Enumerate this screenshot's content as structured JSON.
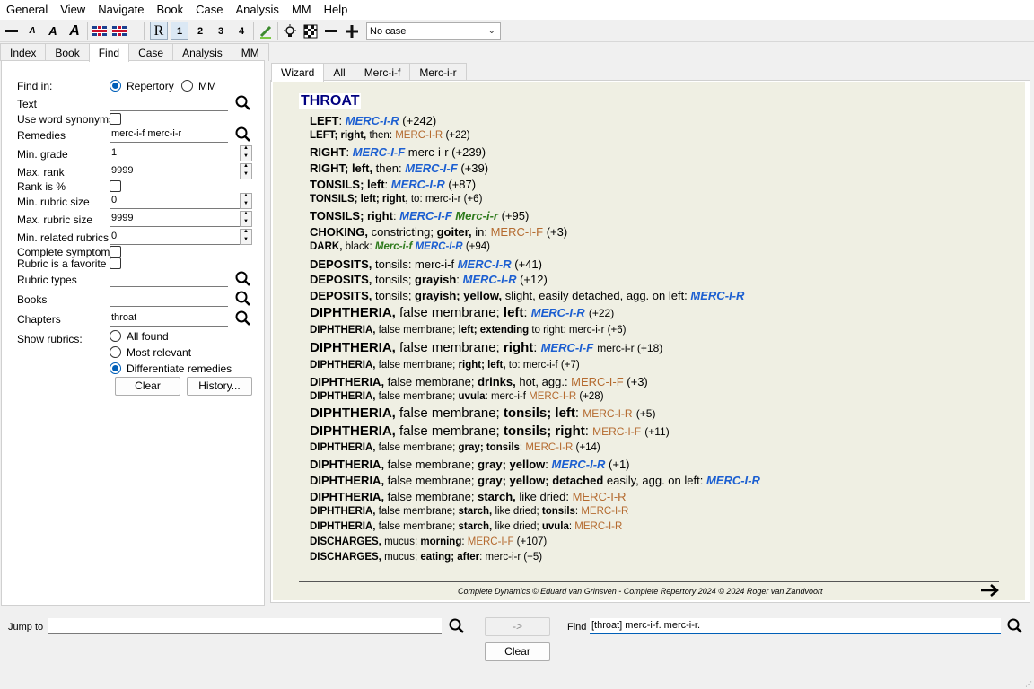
{
  "menu": [
    "General",
    "View",
    "Navigate",
    "Book",
    "Case",
    "Analysis",
    "MM",
    "Help"
  ],
  "toolbar": {
    "font_a_small": "A",
    "font_a_mid": "A",
    "font_a_large": "A",
    "view_r": "R",
    "view_1": "1",
    "view_2": "2",
    "view_3": "3",
    "view_4": "4",
    "case_select": "No case"
  },
  "left_tabs": [
    "Index",
    "Book",
    "Find",
    "Case",
    "Analysis",
    "MM"
  ],
  "find": {
    "find_in_label": "Find in:",
    "opt_repertory": "Repertory",
    "opt_mm": "MM",
    "text_label": "Text",
    "text_value": "",
    "synonyms_label": "Use word synonyms",
    "remedies_label": "Remedies",
    "remedies_value": "merc-i-f merc-i-r",
    "min_grade_label": "Min. grade",
    "min_grade_value": "1",
    "max_rank_label": "Max. rank",
    "max_rank_value": "9999",
    "rank_pct_label": "Rank is %",
    "min_rubric_label": "Min. rubric size",
    "min_rubric_value": "0",
    "max_rubric_label": "Max. rubric size",
    "max_rubric_value": "9999",
    "min_related_label": "Min. related rubrics",
    "min_related_value": "0",
    "complete_label": "Complete symptoms",
    "favorite_label": "Rubric is a favorite",
    "rubric_types_label": "Rubric types",
    "books_label": "Books",
    "chapters_label": "Chapters",
    "chapters_value": "throat",
    "show_label": "Show rubrics:",
    "show_all": "All found",
    "show_relevant": "Most relevant",
    "show_diff": "Differentiate remedies",
    "clear": "Clear",
    "history": "History..."
  },
  "right_tabs": [
    "Wizard",
    "All",
    "Merc-i-f",
    "Merc-i-r"
  ],
  "chapter": "THROAT",
  "footer": "Complete Dynamics © Eduard van Grinsven   -   Complete Repertory 2024 © 2024 Roger van Zandvoort",
  "bottom": {
    "jump_label": "Jump to",
    "jump_value": "",
    "go_label": "->",
    "find_label": "Find",
    "find_value": "[throat] merc-i-f. merc-i-r.",
    "clear": "Clear"
  },
  "colors": {
    "blue": "#1c5fd1",
    "brown": "#b46a2f",
    "green": "#2e7a1c",
    "title": "#000080"
  }
}
